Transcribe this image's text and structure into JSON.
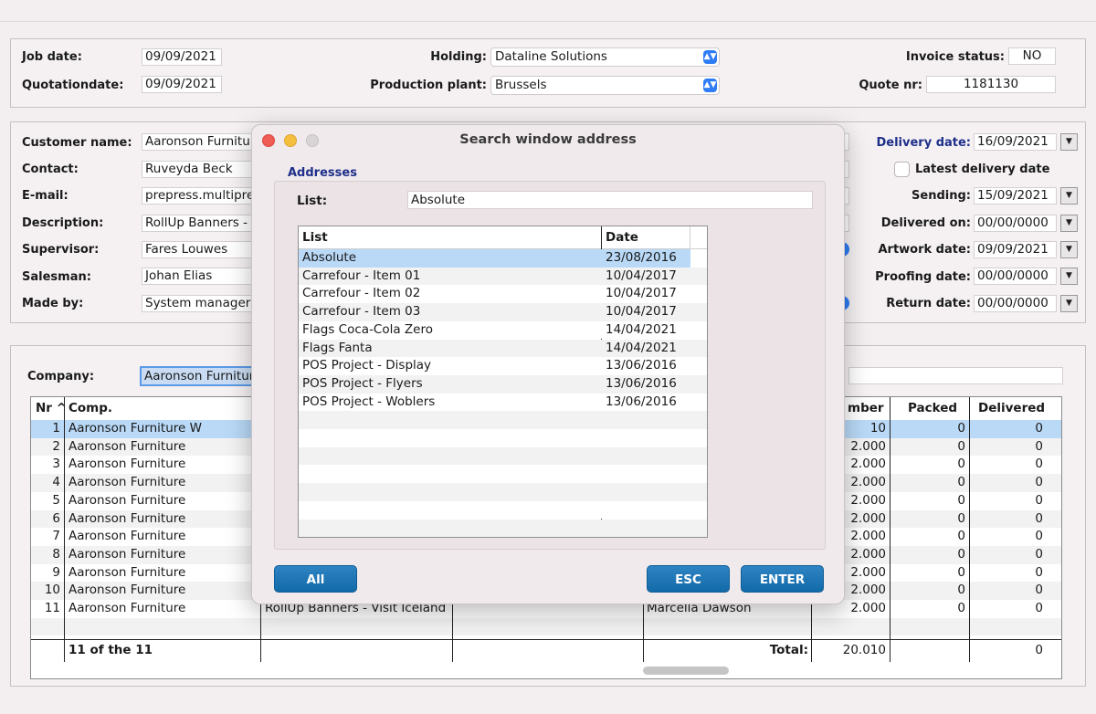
{
  "header": {
    "job_date_label": "Job date:",
    "job_date": "09/09/2021",
    "quotation_date_label": "Quotationdate:",
    "quotation_date": "09/09/2021",
    "holding_label": "Holding:",
    "holding": "Dataline Solutions",
    "production_plant_label": "Production plant:",
    "production_plant": "Brussels",
    "invoice_status_label": "Invoice status:",
    "invoice_status": "NO",
    "quote_nr_label": "Quote nr:",
    "quote_nr": "1181130"
  },
  "customer": {
    "customer_name_label": "Customer name:",
    "customer_name": "Aaronson Furnitur",
    "contact_label": "Contact:",
    "contact": "Ruveyda Beck",
    "email_label": "E-mail:",
    "email": "prepress.multipre",
    "description_label": "Description:",
    "description": "RollUp Banners - V",
    "supervisor_label": "Supervisor:",
    "supervisor": "Fares Louwes",
    "salesman_label": "Salesman:",
    "salesman": "Johan Elias",
    "made_by_label": "Made by:",
    "made_by": "System manager"
  },
  "dates": {
    "delivery_date_label": "Delivery date:",
    "delivery_date": "16/09/2021",
    "latest_delivery_label": "Latest delivery date",
    "sending_label": "Sending:",
    "sending": "15/09/2021",
    "delivered_on_label": "Delivered on:",
    "delivered_on": "00/00/0000",
    "artwork_date_label": "Artwork date:",
    "artwork_date": "09/09/2021",
    "proofing_date_label": "Proofing date:",
    "proofing_date": "00/00/0000",
    "return_date_label": "Return date:",
    "return_date": "00/00/0000"
  },
  "company": {
    "label": "Company:",
    "value": "Aaronson Furnitur"
  },
  "grid": {
    "headers": {
      "nr": "Nr",
      "comp": "Comp.",
      "number": "mber",
      "packed": "Packed",
      "delivered": "Delivered"
    },
    "rows": [
      {
        "nr": "1",
        "comp": "Aaronson Furniture W",
        "number": "10",
        "packed": "0",
        "delivered": "0"
      },
      {
        "nr": "2",
        "comp": "Aaronson Furniture",
        "number": "2.000",
        "packed": "0",
        "delivered": "0"
      },
      {
        "nr": "3",
        "comp": "Aaronson Furniture",
        "number": "2.000",
        "packed": "0",
        "delivered": "0"
      },
      {
        "nr": "4",
        "comp": "Aaronson Furniture",
        "number": "2.000",
        "packed": "0",
        "delivered": "0"
      },
      {
        "nr": "5",
        "comp": "Aaronson Furniture",
        "number": "2.000",
        "packed": "0",
        "delivered": "0"
      },
      {
        "nr": "6",
        "comp": "Aaronson Furniture",
        "number": "2.000",
        "packed": "0",
        "delivered": "0"
      },
      {
        "nr": "7",
        "comp": "Aaronson Furniture",
        "number": "2.000",
        "packed": "0",
        "delivered": "0"
      },
      {
        "nr": "8",
        "comp": "Aaronson Furniture",
        "number": "2.000",
        "packed": "0",
        "delivered": "0"
      },
      {
        "nr": "9",
        "comp": "Aaronson Furniture",
        "number": "2.000",
        "packed": "0",
        "delivered": "0"
      },
      {
        "nr": "10",
        "comp": "Aaronson Furniture",
        "number": "2.000",
        "packed": "0",
        "delivered": "0"
      },
      {
        "nr": "11",
        "comp": "Aaronson Furniture",
        "number": "2.000",
        "packed": "0",
        "delivered": "0"
      }
    ],
    "row11_description": "RollUp Banners - Visit Iceland",
    "row11_contact": "Marcella Dawson",
    "footer_count": "11 of the 11",
    "footer_total_label": "Total:",
    "footer_total": "20.010",
    "footer_delivered": "0"
  },
  "dialog": {
    "title": "Search window address",
    "section": "Addresses",
    "list_label": "List:",
    "list_value": "Absolute",
    "col_list": "List",
    "col_date": "Date",
    "items": [
      {
        "name": "Absolute",
        "date": "23/08/2016"
      },
      {
        "name": "Carrefour - Item 01",
        "date": "10/04/2017"
      },
      {
        "name": "Carrefour - Item 02",
        "date": "10/04/2017"
      },
      {
        "name": "Carrefour - Item 03",
        "date": "10/04/2017"
      },
      {
        "name": "Flags Coca-Cola Zero",
        "date": "14/04/2021"
      },
      {
        "name": "Flags Fanta",
        "date": "14/04/2021"
      },
      {
        "name": "POS Project - Display",
        "date": "13/06/2016"
      },
      {
        "name": "POS Project - Flyers",
        "date": "13/06/2016"
      },
      {
        "name": "POS Project - Woblers",
        "date": "13/06/2016"
      }
    ],
    "btn_all": "All",
    "btn_esc": "ESC",
    "btn_enter": "ENTER"
  },
  "colors": {
    "selection": "#b9d9f7",
    "accent": "#2e7cf6",
    "button": "#1f74b4",
    "label_blue": "#1e2f8a"
  }
}
